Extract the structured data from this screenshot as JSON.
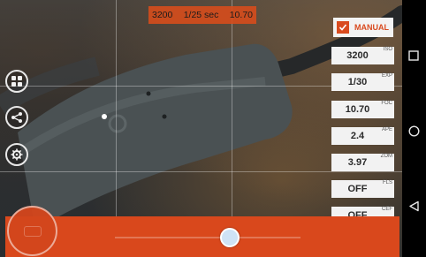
{
  "top_info": {
    "iso": "3200",
    "shutter": "1/25 sec",
    "focus": "10.70"
  },
  "mode": {
    "label": "MANUAL",
    "checked": true
  },
  "params": [
    {
      "value": "3200",
      "tag": "ISO"
    },
    {
      "value": "1/30",
      "tag": "EXP"
    },
    {
      "value": "10.70",
      "tag": "FOC"
    },
    {
      "value": "2.4",
      "tag": "APE"
    },
    {
      "value": "3.97",
      "tag": "ZOM"
    },
    {
      "value": "OFF",
      "tag": "FLS"
    },
    {
      "value": "OFF",
      "tag": "CEF"
    }
  ],
  "left_icons": [
    "grid-icon",
    "share-icon",
    "settings-icon"
  ],
  "slider": {
    "position_fraction": 0.62
  },
  "colors": {
    "accent": "#d9481c",
    "panel": "#f2f2f2"
  },
  "nav": [
    "recents-icon",
    "home-icon",
    "back-icon"
  ]
}
